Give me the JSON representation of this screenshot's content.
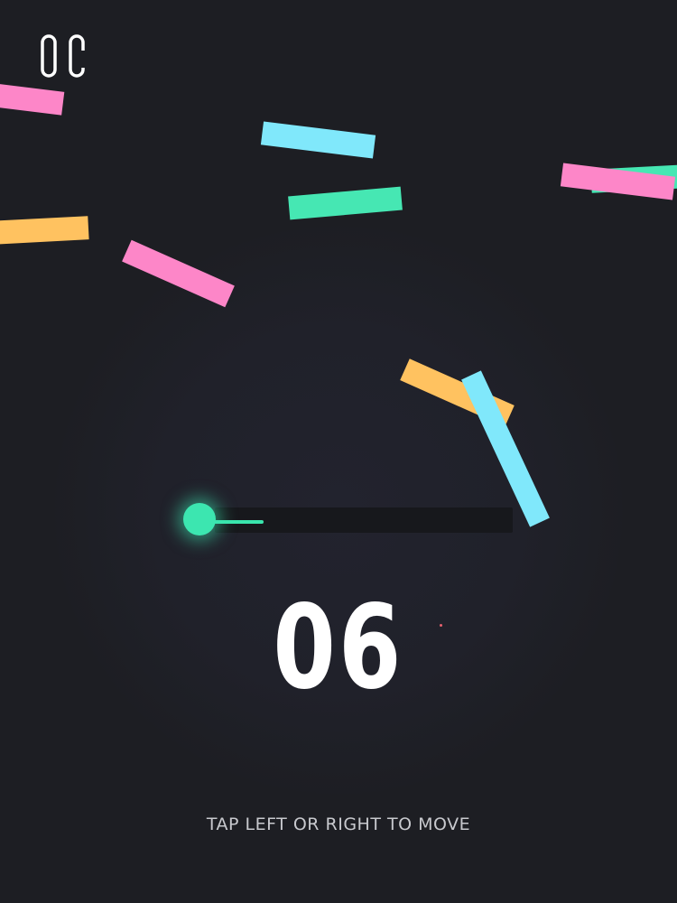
{
  "game": {
    "score": "06",
    "hint": "TAP LEFT OR RIGHT TO MOVE"
  },
  "pause_button": {
    "icon": "pause-icon"
  },
  "colors": {
    "background": "#1d1e23",
    "pink": "#fd86c8",
    "cyan": "#80e8fb",
    "mint": "#46e7b3",
    "orange": "#ffc260",
    "player": "#3ce6b0",
    "text": "#ffffff"
  },
  "obstacles": [
    {
      "color": "pink"
    },
    {
      "color": "cyan"
    },
    {
      "color": "mint"
    },
    {
      "color": "pink"
    },
    {
      "color": "mint"
    },
    {
      "color": "orange"
    },
    {
      "color": "pink"
    },
    {
      "color": "orange"
    },
    {
      "color": "cyan"
    }
  ]
}
